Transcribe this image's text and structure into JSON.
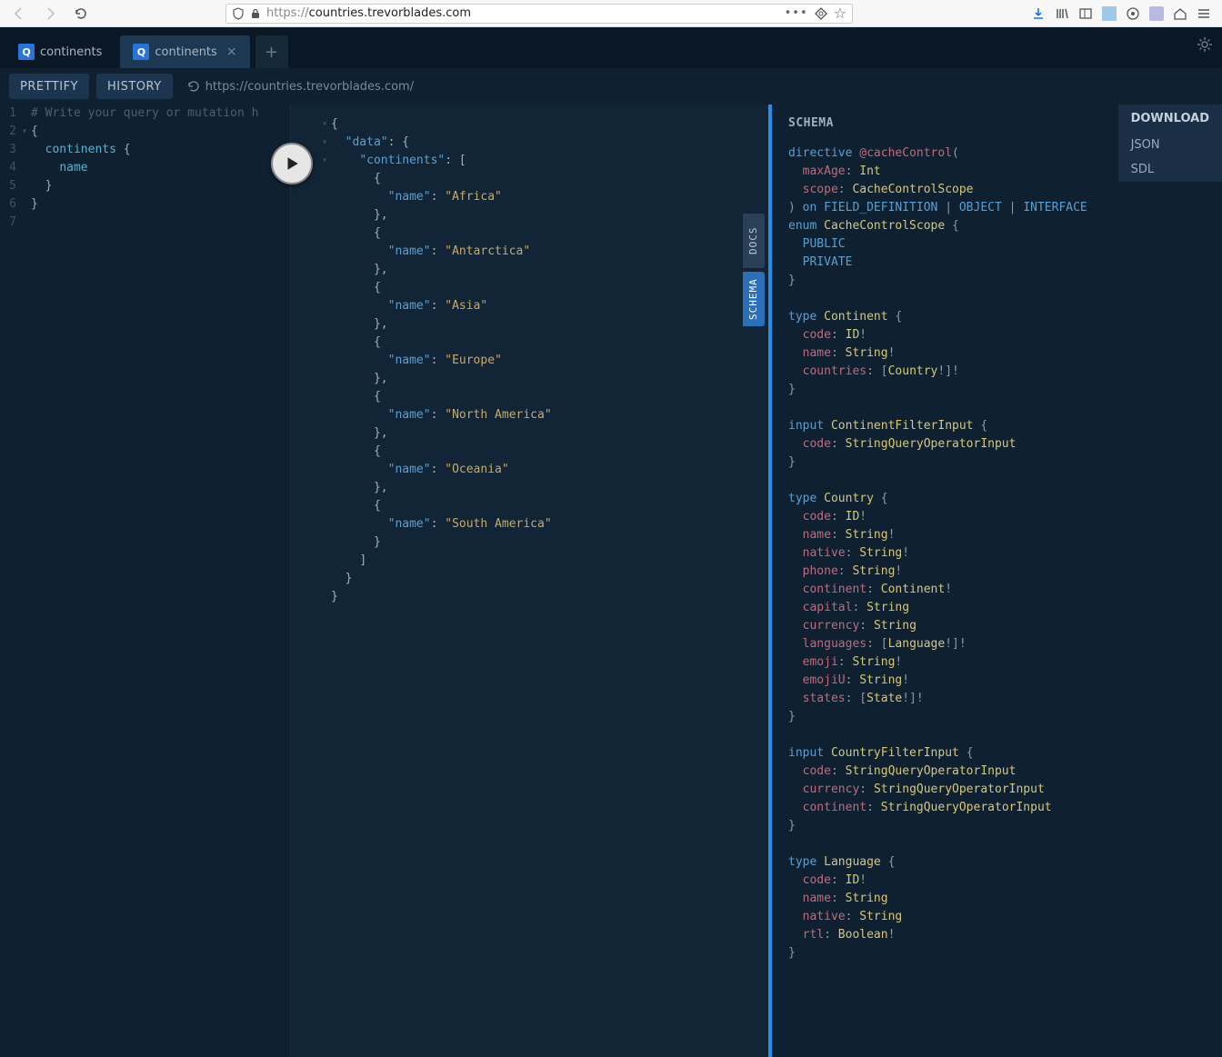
{
  "browser": {
    "url_display": "https://countries.trevorblades.com",
    "url_host_prefix": "https://",
    "url_host_bold": "countries.trevorblades.com"
  },
  "app_tabs": [
    {
      "label": "continents",
      "active": false,
      "closeable": false
    },
    {
      "label": "continents",
      "active": true,
      "closeable": true
    }
  ],
  "toolbar": {
    "prettify": "PRETTIFY",
    "history": "HISTORY",
    "endpoint": "https://countries.trevorblades.com/"
  },
  "editor_comment": "# Write your query or mutation h",
  "editor_query_lines": [
    "{",
    "  continents {",
    "    name",
    "  }",
    "}"
  ],
  "response_data": {
    "continents": [
      {
        "name": "Africa"
      },
      {
        "name": "Antarctica"
      },
      {
        "name": "Asia"
      },
      {
        "name": "Europe"
      },
      {
        "name": "North America"
      },
      {
        "name": "Oceania"
      },
      {
        "name": "South America"
      }
    ]
  },
  "side_tabs": {
    "docs": "DOCS",
    "schema": "SCHEMA"
  },
  "schema_panel": {
    "title": "SCHEMA",
    "download": {
      "header": "DOWNLOAD",
      "json": "JSON",
      "sdl": "SDL"
    }
  },
  "schema_sdl": {
    "directive": {
      "name": "@cacheControl",
      "args": [
        {
          "name": "maxAge",
          "type": "Int"
        },
        {
          "name": "scope",
          "type": "CacheControlScope"
        }
      ],
      "on": [
        "FIELD_DEFINITION",
        "OBJECT",
        "INTERFACE"
      ]
    },
    "enums": [
      {
        "name": "CacheControlScope",
        "values": [
          "PUBLIC",
          "PRIVATE"
        ]
      }
    ],
    "types": [
      {
        "kind": "type",
        "name": "Continent",
        "fields": [
          {
            "name": "code",
            "type": "ID",
            "nn": true
          },
          {
            "name": "name",
            "type": "String",
            "nn": true
          },
          {
            "name": "countries",
            "type": "Country",
            "list": true,
            "innerNN": true,
            "nn": true
          }
        ]
      },
      {
        "kind": "input",
        "name": "ContinentFilterInput",
        "fields": [
          {
            "name": "code",
            "type": "StringQueryOperatorInput"
          }
        ]
      },
      {
        "kind": "type",
        "name": "Country",
        "fields": [
          {
            "name": "code",
            "type": "ID",
            "nn": true
          },
          {
            "name": "name",
            "type": "String",
            "nn": true
          },
          {
            "name": "native",
            "type": "String",
            "nn": true
          },
          {
            "name": "phone",
            "type": "String",
            "nn": true
          },
          {
            "name": "continent",
            "type": "Continent",
            "nn": true
          },
          {
            "name": "capital",
            "type": "String"
          },
          {
            "name": "currency",
            "type": "String"
          },
          {
            "name": "languages",
            "type": "Language",
            "list": true,
            "innerNN": true,
            "nn": true
          },
          {
            "name": "emoji",
            "type": "String",
            "nn": true
          },
          {
            "name": "emojiU",
            "type": "String",
            "nn": true
          },
          {
            "name": "states",
            "type": "State",
            "list": true,
            "innerNN": true,
            "nn": true
          }
        ]
      },
      {
        "kind": "input",
        "name": "CountryFilterInput",
        "fields": [
          {
            "name": "code",
            "type": "StringQueryOperatorInput"
          },
          {
            "name": "currency",
            "type": "StringQueryOperatorInput"
          },
          {
            "name": "continent",
            "type": "StringQueryOperatorInput"
          }
        ]
      },
      {
        "kind": "type",
        "name": "Language",
        "fields": [
          {
            "name": "code",
            "type": "ID",
            "nn": true
          },
          {
            "name": "name",
            "type": "String"
          },
          {
            "name": "native",
            "type": "String"
          },
          {
            "name": "rtl",
            "type": "Boolean",
            "nn": true
          }
        ]
      }
    ]
  }
}
